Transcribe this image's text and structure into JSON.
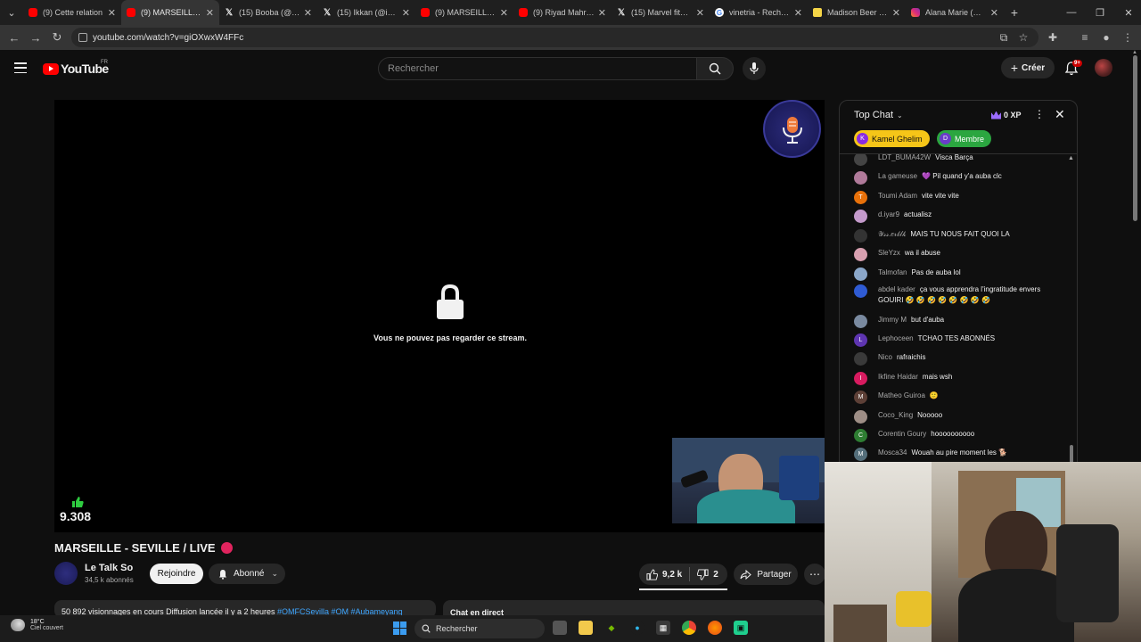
{
  "browser": {
    "tabs": [
      {
        "title": "(9) Cette relation",
        "favicon": "youtube-icon",
        "active": false
      },
      {
        "title": "(9) MARSEILLE - S",
        "favicon": "youtube-icon",
        "active": true
      },
      {
        "title": "(15) Booba (@bo",
        "favicon": "x-icon",
        "active": false
      },
      {
        "title": "(15) Ikkan (@ikka",
        "favicon": "x-icon",
        "active": false
      },
      {
        "title": "(9) MARSEILLE - S",
        "favicon": "youtube-icon",
        "active": false
      },
      {
        "title": "(9) Riyad Mahrez",
        "favicon": "youtube-icon",
        "active": false
      },
      {
        "title": "(15) Marvel fitnes",
        "favicon": "x-icon",
        "active": false
      },
      {
        "title": "vinetria - Recherc",
        "favicon": "google-icon",
        "active": false
      },
      {
        "title": "Madison Beer - In",
        "favicon": "mb-icon",
        "active": false
      },
      {
        "title": "Alana Marie (@al",
        "favicon": "instagram-icon",
        "active": false
      }
    ],
    "url": "youtube.com/watch?v=giOXwxW4FFc"
  },
  "yt_header": {
    "logo_text": "YouTube",
    "country_code": "FR",
    "search_placeholder": "Rechercher",
    "create_label": "Créer",
    "notif_badge": "9+"
  },
  "player": {
    "blocked_message": "Vous ne pouvez pas regarder ce stream.",
    "like_count_overlay": "9.308"
  },
  "video": {
    "title": "MARSEILLE - SEVILLE / LIVE",
    "channel_name": "Le Talk So",
    "subscribers": "34,5 k abonnés",
    "join_label": "Rejoindre",
    "subscribed_label": "Abonné",
    "likes": "9,2 k",
    "dislikes": "2",
    "share_label": "Partager",
    "description_text": "50 892 visionnages en cours  Diffusion lancée il y a 2 heures ",
    "description_tags": "#OMFCSevilla #OM #Aubameyang",
    "chat_replay_label": "Chat en direct"
  },
  "chat": {
    "mode_label": "Top Chat",
    "xp_label": "0 XP",
    "pills": [
      {
        "initial": "K",
        "label": "Kamel Ghelim"
      },
      {
        "initial": "D",
        "label": "Membre"
      }
    ],
    "messages": [
      {
        "author": "LDT_BUMA42W",
        "text": "Visca Barça",
        "avatar_color": "#444444",
        "initial": ""
      },
      {
        "author": "La gameuse",
        "text": "💜 Pil quand y'a auba clc",
        "avatar_color": "#b07a9a",
        "initial": ""
      },
      {
        "author": "Toumi Adam",
        "text": "vite vite vite",
        "avatar_color": "#e8710a",
        "initial": "T"
      },
      {
        "author": "d.iyar9",
        "text": "actualisz",
        "avatar_color": "#c49acb",
        "initial": ""
      },
      {
        "author": "𝒴𝓈𝓈.𝑒𝓇𝒷𝓁𝓀",
        "text": "MAIS TU NOUS FAIT QUOI LA",
        "avatar_color": "#333333",
        "initial": ""
      },
      {
        "author": "SleYzx",
        "text": "wa il abuse",
        "avatar_color": "#d8a0b0",
        "initial": ""
      },
      {
        "author": "Talmofan",
        "text": "Pas de auba lol",
        "avatar_color": "#8aa6c8",
        "initial": ""
      },
      {
        "author": "abdel kader",
        "text": "ça vous apprendra l'ingratitude envers GOUIRI 🤣 🤣 🤣 🤣 🤣 🤣 🤣 🤣",
        "avatar_color": "#2f5bd3",
        "initial": ""
      },
      {
        "author": "Jimmy M",
        "text": "but d'auba",
        "avatar_color": "#7a8aa0",
        "initial": ""
      },
      {
        "author": "Lephoceen",
        "text": "TCHAO TES ABONNÉS",
        "avatar_color": "#5e35b1",
        "initial": "L"
      },
      {
        "author": "Nico",
        "text": "rafraichis",
        "avatar_color": "#3a3a3a",
        "initial": ""
      },
      {
        "author": "Ikfine Haidar",
        "text": "mais wsh",
        "avatar_color": "#d81b60",
        "initial": "I"
      },
      {
        "author": "Matheo Guiroa",
        "text": "🙂",
        "avatar_color": "#5d4037",
        "initial": "M"
      },
      {
        "author": "Coco_King",
        "text": "Nooooo",
        "avatar_color": "#9e8e86",
        "initial": ""
      },
      {
        "author": "Corentin Goury",
        "text": "hoooooooooo",
        "avatar_color": "#2e7d32",
        "initial": "C"
      },
      {
        "author": "Mosca34",
        "text": "Wouah au pire moment les 🐕",
        "avatar_color": "#546e7a",
        "initial": "M"
      }
    ]
  },
  "taskbar": {
    "temperature": "18°C",
    "condition": "Ciel couvert",
    "search_placeholder": "Rechercher"
  },
  "colors": {
    "youtube_red": "#ff0000",
    "live_dot": "#e0245e",
    "tag_link": "#3ea6ff",
    "pill_gold": "#f5c518",
    "pill_green": "#2ba640"
  }
}
